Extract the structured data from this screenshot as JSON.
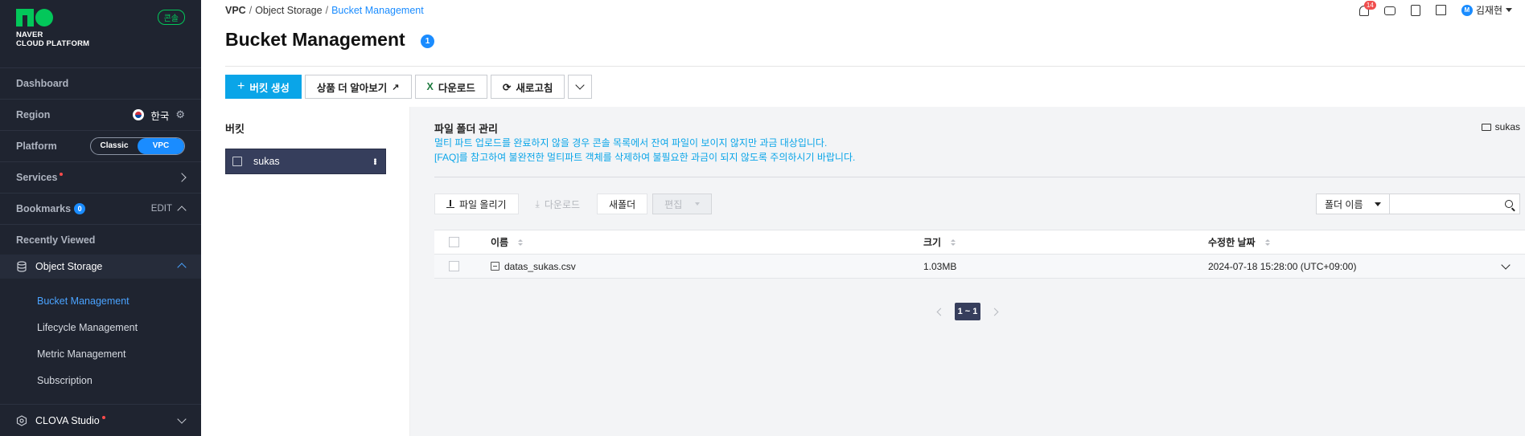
{
  "brand": {
    "line1": "NAVER",
    "line2": "CLOUD PLATFORM",
    "console_badge": "콘솔"
  },
  "sidebar": {
    "dashboard": "Dashboard",
    "region": {
      "label": "Region",
      "value": "한국"
    },
    "platform": {
      "label": "Platform",
      "classic": "Classic",
      "vpc": "VPC"
    },
    "services": "Services",
    "bookmarks": {
      "label": "Bookmarks",
      "count": "0",
      "edit": "EDIT"
    },
    "recently_viewed": "Recently Viewed",
    "object_storage": "Object Storage",
    "sub_items": [
      "Bucket Management",
      "Lifecycle Management",
      "Metric Management",
      "Subscription"
    ],
    "clova": "CLOVA Studio"
  },
  "breadcrumb": {
    "root": "VPC",
    "parent": "Object Storage",
    "current": "Bucket Management"
  },
  "page": {
    "title": "Bucket Management",
    "title_badge": "1"
  },
  "header": {
    "notifications": "14",
    "user_initial": "M",
    "user_name": "김재현"
  },
  "toolbar": {
    "create": "버킷 생성",
    "learn_more": "상품 더 알아보기",
    "download": "다운로드",
    "refresh": "새로고침"
  },
  "buckets": {
    "heading": "버킷",
    "items": [
      {
        "name": "sukas"
      }
    ]
  },
  "file_panel": {
    "title": "파일 폴더 관리",
    "path": "sukas",
    "notice1": "멀티 파트 업로드를 완료하지 않을 경우 콘솔 목록에서 잔여 파일이 보이지 않지만 과금 대상입니다.",
    "notice2": "[FAQ]를 참고하여 불완전한 멀티파트 객체를 삭제하여 불필요한 과금이 되지 않도록 주의하시기 바랍니다.",
    "upload": "파일 올리기",
    "download": "다운로드",
    "new_folder": "새폴더",
    "edit": "편집",
    "search_select": "폴더 이름",
    "columns": {
      "name": "이름",
      "size": "크기",
      "modified": "수정한 날짜"
    },
    "rows": [
      {
        "name": "datas_sukas.csv",
        "size": "1.03MB",
        "modified": "2024-07-18 15:28:00 (UTC+09:00)"
      }
    ],
    "pager": "1 ~ 1"
  },
  "colors": {
    "sidebar_bg": "#1f2430",
    "accent": "#1a8cff",
    "primary_btn": "#0aa5e8",
    "brand_green": "#03c75a"
  }
}
